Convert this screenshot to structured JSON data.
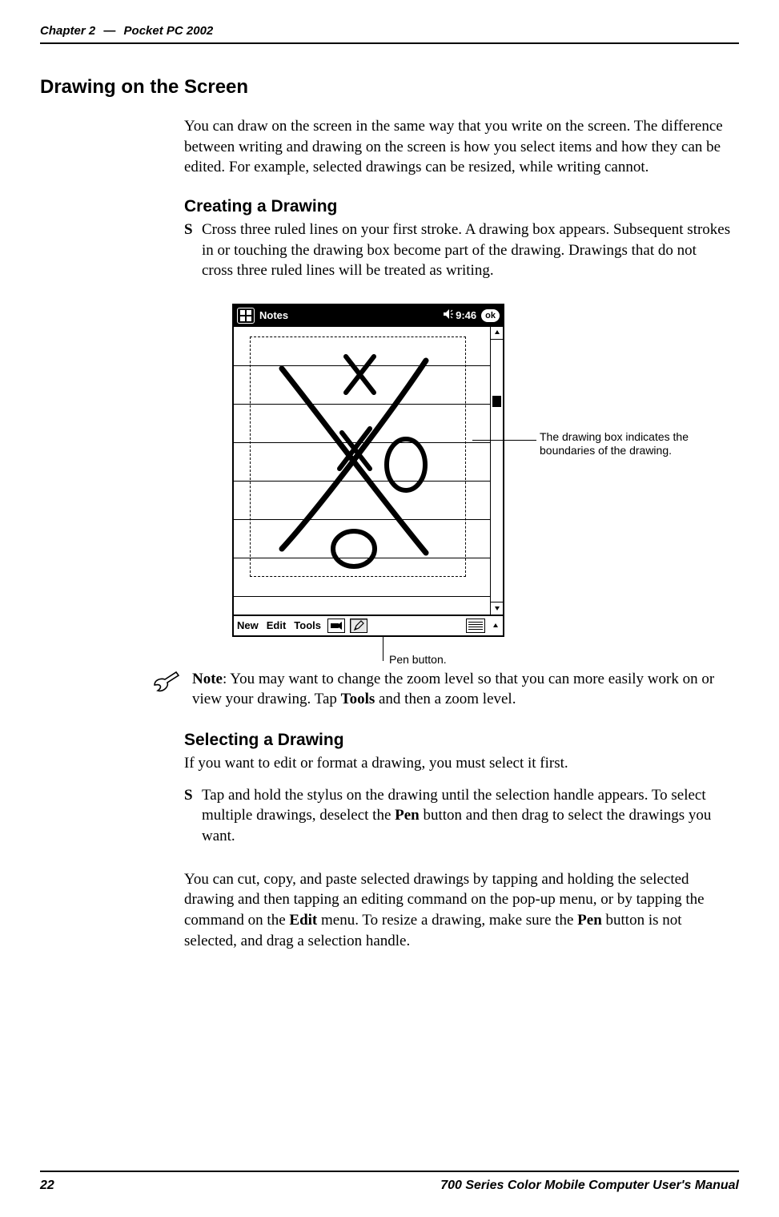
{
  "header": {
    "chapter": "Chapter 2",
    "separator": "—",
    "product": "Pocket PC 2002"
  },
  "section_title": "Drawing on the Screen",
  "intro_para": "You can draw on the screen in the same way that you write on the screen. The difference between writing and drawing on the screen is how you select items and how they can be edited. For example, selected drawings can be resized, while writing cannot.",
  "creating": {
    "title": "Creating a Drawing",
    "bullet": "Cross three ruled lines on your first stroke. A drawing box appears. Subsequent strokes in or touching the drawing box become part of the drawing. Drawings that do not cross three ruled lines will be treated as writing."
  },
  "screenshot": {
    "app_title": "Notes",
    "time": "9:46",
    "ok_label": "ok",
    "menu": {
      "new": "New",
      "edit": "Edit",
      "tools": "Tools"
    },
    "callout_box": "The drawing box indicates the boundaries of the drawing.",
    "callout_pen": "Pen button."
  },
  "note": {
    "bold_label": "Note",
    "text_before": ": You may want to change the zoom level so that you can more easily work on or view your drawing. Tap ",
    "tools_word": "Tools",
    "text_after": " and then a zoom level."
  },
  "selecting": {
    "title": "Selecting a Drawing",
    "intro": "If you want to edit or format a drawing, you must select it first.",
    "bullet_before": "Tap and hold the stylus on the drawing until the selection handle appears. To select multiple drawings, deselect the ",
    "pen_word": "Pen",
    "bullet_after": " button and then drag to select the drawings you want.",
    "para2_before": "You can cut, copy, and paste selected drawings by tapping and holding the selected drawing and then tapping an editing command on the pop-up menu, or by tapping the command on the ",
    "edit_word": "Edit",
    "para2_mid": " menu. To resize a drawing, make sure the ",
    "pen_word2": "Pen",
    "para2_after": " button is not selected, and drag a selection handle."
  },
  "footer": {
    "page": "22",
    "manual": "700 Series Color Mobile Computer User's Manual"
  }
}
